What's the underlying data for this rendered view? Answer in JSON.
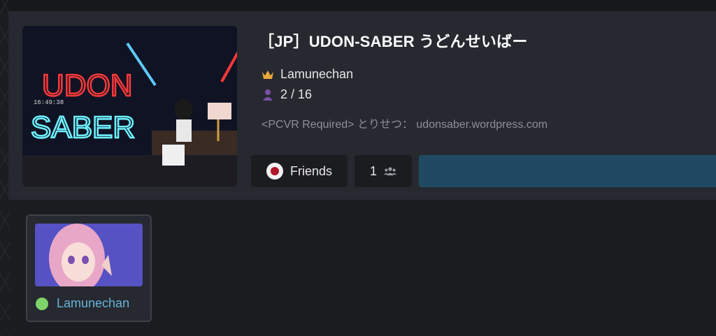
{
  "world": {
    "title": "［JP］UDON-SABER うどんせいばー",
    "author": "Lamunechan",
    "capacity": "2 / 16",
    "description": "<PCVR Required> とりせつ： udonsaber.wordpress.com",
    "thumbnail_text": [
      "UDON",
      "SABER"
    ],
    "thumbnail_clock": "16:49:38"
  },
  "actions": {
    "friends_label": "Friends",
    "count_label": "1"
  },
  "friends": [
    {
      "name": "Lamunechan",
      "status": "online"
    }
  ],
  "colors": {
    "accent_launch": "#1f4a62",
    "online": "#7ed46b",
    "friend_name": "#67b3d8",
    "crown": "#e8a83a",
    "capacity_icon": "#7a4fa8"
  },
  "icons": {
    "author": "crown-icon",
    "capacity": "person-icon",
    "friends_toggle": "friends-dot-icon",
    "count": "group-icon",
    "status": "online-status-icon"
  }
}
